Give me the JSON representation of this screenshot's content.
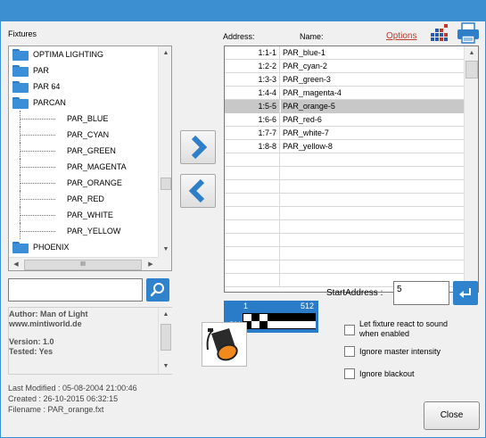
{
  "colors": {
    "accent": "#3c90d2",
    "link": "#c0392b",
    "selected_row": "#c8c8c8"
  },
  "labels": {
    "fixtures": "Fixtures",
    "address": "Address:",
    "name": "Name:",
    "options": "Options",
    "start_address": "StartAddress :"
  },
  "tree": {
    "folders": [
      "OPTIMA LIGHTING",
      "PAR",
      "PAR 64",
      "PARCAN"
    ],
    "children": [
      "PAR_BLUE",
      "PAR_CYAN",
      "PAR_GREEN",
      "PAR_MAGENTA",
      "PAR_ORANGE",
      "PAR_RED",
      "PAR_WHITE",
      "PAR_YELLOW"
    ],
    "last_folder": "PHOENIX",
    "hscroll_thumb_label": "III"
  },
  "grid": {
    "rows": [
      {
        "addr": "1:1-1",
        "name": "PAR_blue-1"
      },
      {
        "addr": "1:2-2",
        "name": "PAR_cyan-2"
      },
      {
        "addr": "1:3-3",
        "name": "PAR_green-3"
      },
      {
        "addr": "1:4-4",
        "name": "PAR_magenta-4"
      },
      {
        "addr": "1:5-5",
        "name": "PAR_orange-5"
      },
      {
        "addr": "1:6-6",
        "name": "PAR_red-6"
      },
      {
        "addr": "1:7-7",
        "name": "PAR_white-7"
      },
      {
        "addr": "1:8-8",
        "name": "PAR_yellow-8"
      }
    ],
    "selected_index": 4
  },
  "dip": {
    "min": "1",
    "max": "512",
    "on_label": "ON"
  },
  "search": {
    "value": ""
  },
  "start_address": {
    "value": "5"
  },
  "info": {
    "author": "Author: Man of Light",
    "website": "www.mintiworld.de",
    "version": "Version: 1.0",
    "tested": "Tested: Yes"
  },
  "meta": {
    "last_modified": "Last Modified : 05-08-2004 21:00:46",
    "created": "Created : 26-10-2015 06:32:15",
    "filename": "Filename : PAR_orange.fxt"
  },
  "options": {
    "react_sound": "Let fixture react to sound when enabled",
    "ignore_master": "Ignore master intensity",
    "ignore_blackout": "Ignore blackout"
  },
  "buttons": {
    "close": "Close"
  },
  "icons": {
    "folder": "folder-icon",
    "search": "search-icon",
    "right": "arrow-right-icon",
    "left": "arrow-left-icon",
    "enter": "enter-icon",
    "spotlight": "spotlight-icon",
    "grid": "grid-icon",
    "printer": "printer-icon"
  }
}
